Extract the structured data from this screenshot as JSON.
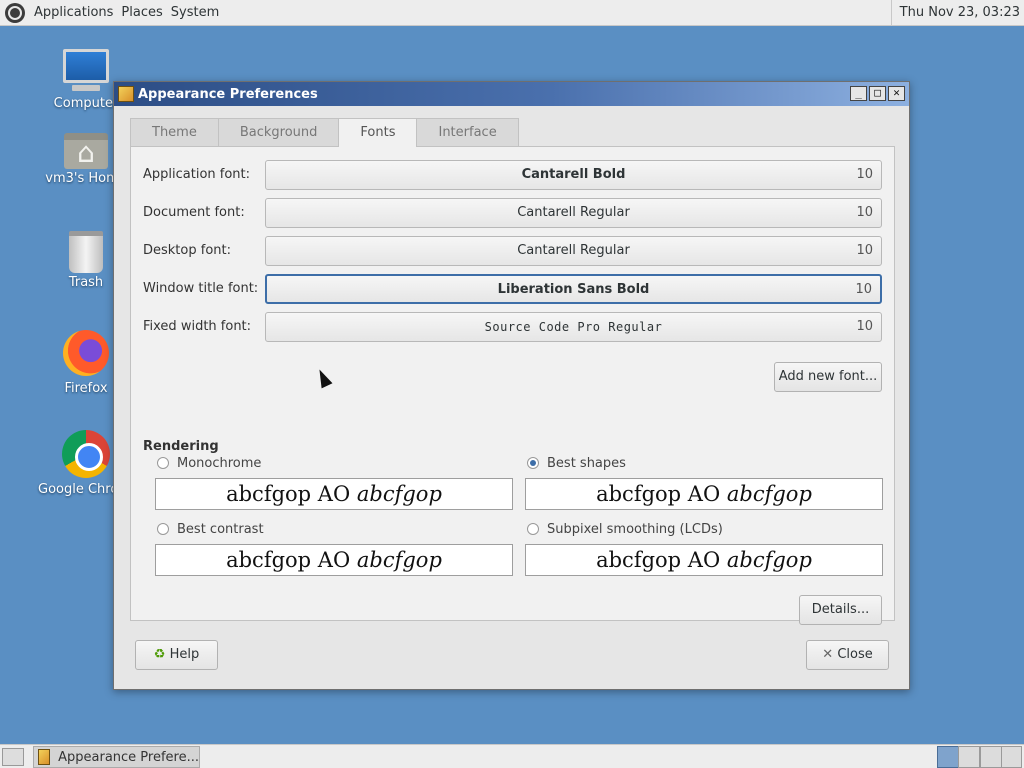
{
  "top_panel": {
    "menus": [
      "Applications",
      "Places",
      "System"
    ],
    "clock": "Thu Nov 23, 03:23"
  },
  "desktop_icons": [
    {
      "label": "Computer",
      "icon": "computer-icon"
    },
    {
      "label": "vm3's Home",
      "icon": "home-folder-icon"
    },
    {
      "label": "Trash",
      "icon": "trash-icon"
    },
    {
      "label": "Firefox",
      "icon": "firefox-icon"
    },
    {
      "label": "Google Chrome",
      "icon": "chrome-icon"
    }
  ],
  "window": {
    "title": "Appearance Preferences",
    "wm_buttons": {
      "minimize": "_",
      "maximize": "□",
      "close": "✕"
    },
    "tabs": [
      "Theme",
      "Background",
      "Fonts",
      "Interface"
    ],
    "active_tab": "Fonts",
    "fonts": [
      {
        "label": "Application font:",
        "font": "Cantarell Bold",
        "size": "10"
      },
      {
        "label": "Document font:",
        "font": "Cantarell Regular",
        "size": "10"
      },
      {
        "label": "Desktop font:",
        "font": "Cantarell Regular",
        "size": "10"
      },
      {
        "label": "Window title font:",
        "font": "Liberation Sans Bold",
        "size": "10"
      },
      {
        "label": "Fixed width font:",
        "font": "Source Code Pro Regular",
        "size": "10"
      }
    ],
    "add_font_label": "Add new font...",
    "rendering": {
      "title": "Rendering",
      "sample_regular": "abcfgop AO ",
      "sample_italic": "abcfgop",
      "options": [
        {
          "label": "Monochrome",
          "checked": false
        },
        {
          "label": "Best shapes",
          "checked": true
        },
        {
          "label": "Best contrast",
          "checked": false
        },
        {
          "label": "Subpixel smoothing (LCDs)",
          "checked": false
        }
      ]
    },
    "details_label": "Details...",
    "help_label": "Help",
    "close_label": "Close"
  },
  "taskbar": {
    "task_label": "Appearance Prefere..."
  }
}
